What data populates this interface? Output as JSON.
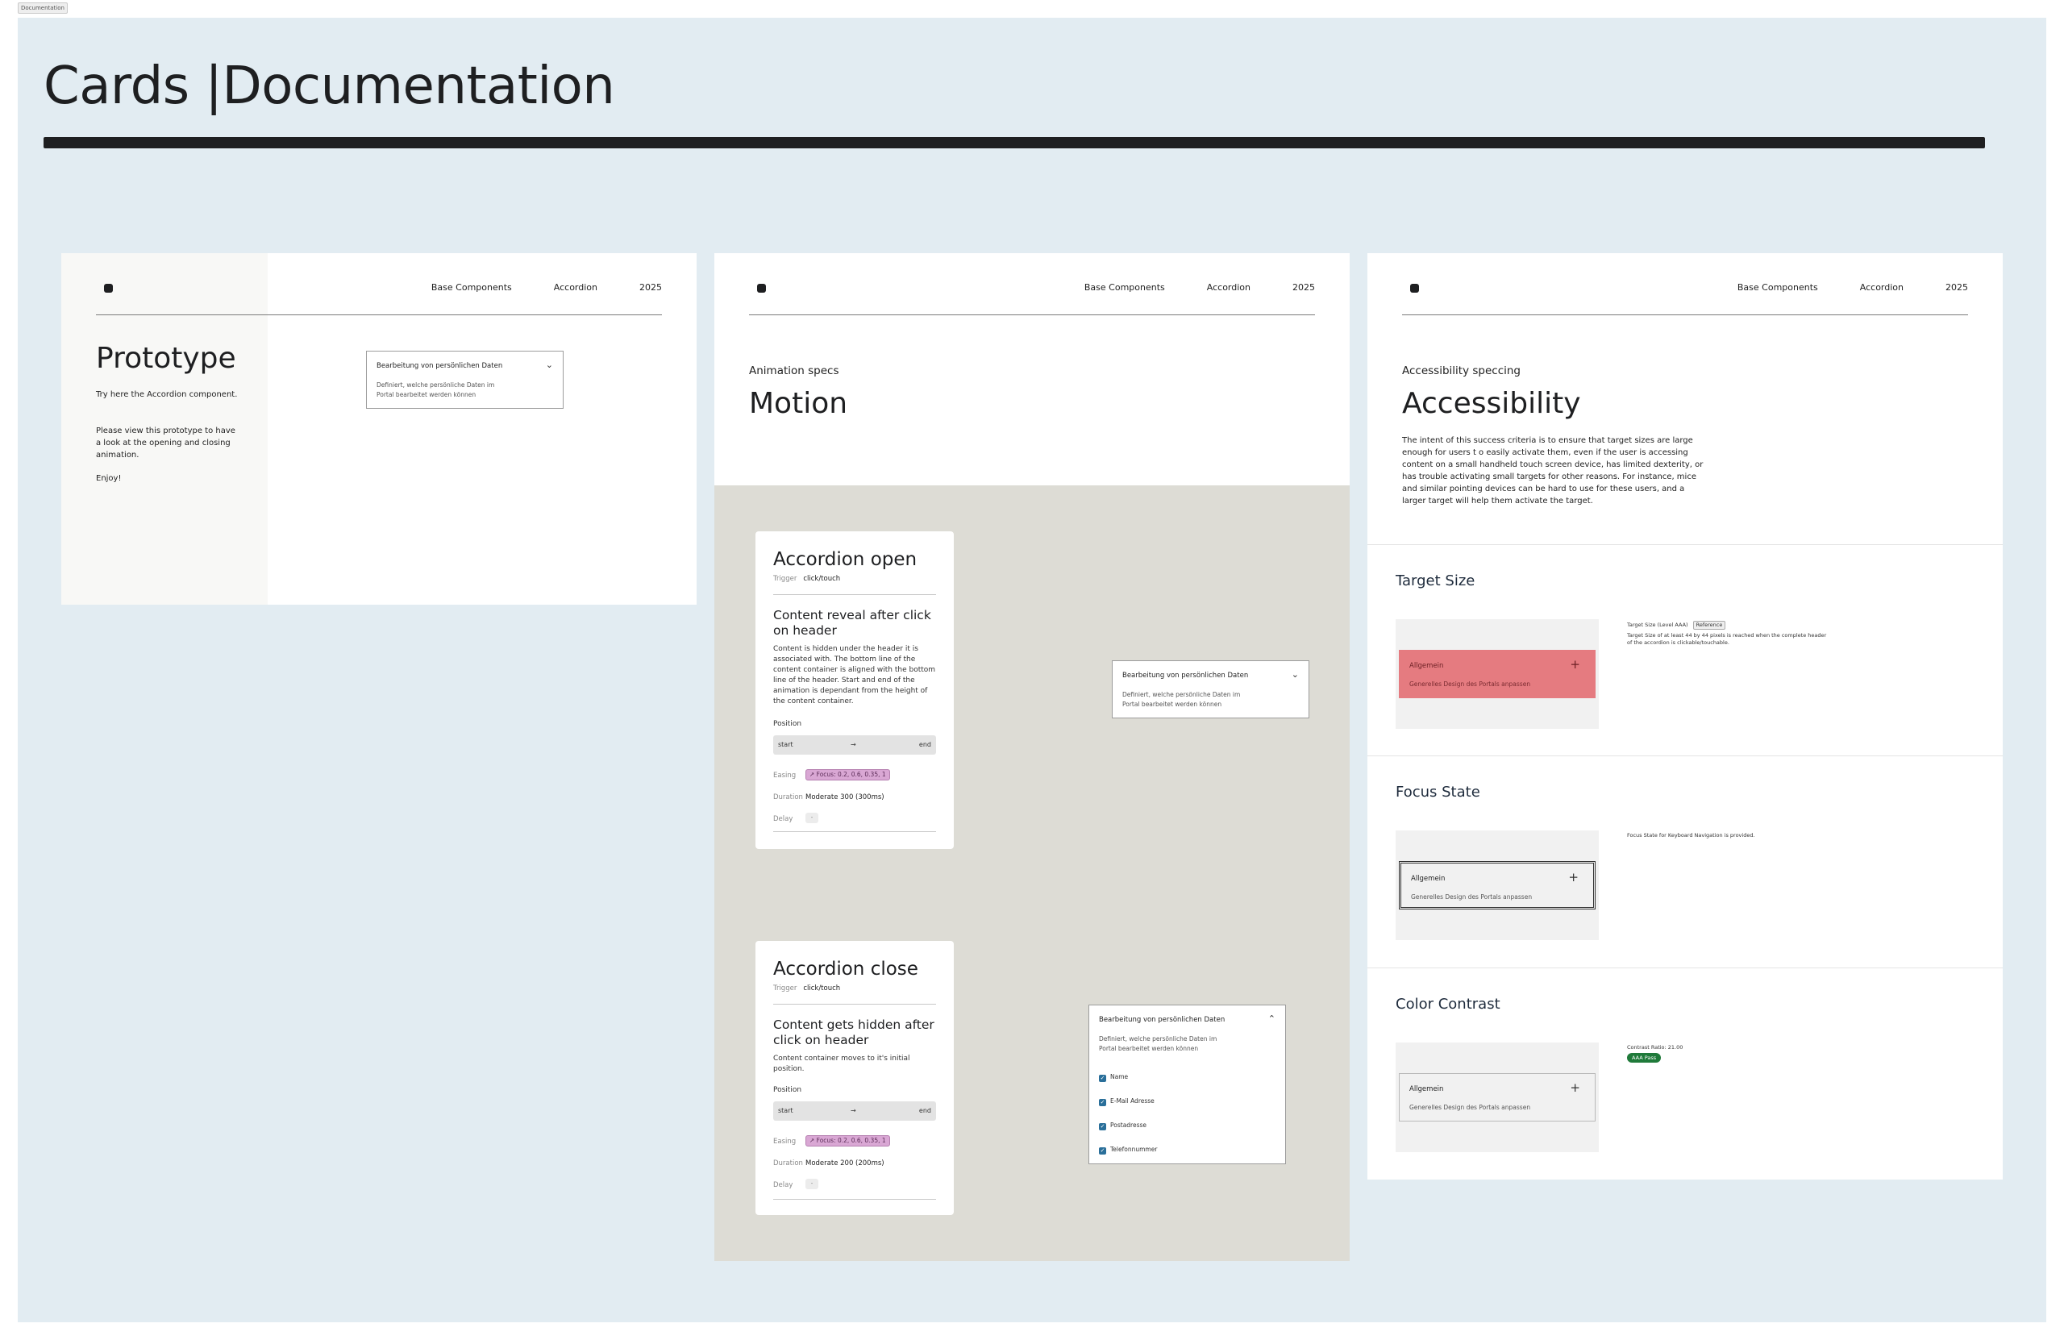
{
  "window_tag": "Documentation",
  "page": {
    "title": "Cards |Documentation"
  },
  "nav": {
    "items": [
      "Base Components",
      "Accordion",
      "2025"
    ]
  },
  "prototype": {
    "heading": "Prototype",
    "paragraphs": [
      "Try here the Accordion component.",
      "Please view this prototype to have a look at the opening and closing animation.",
      "Enjoy!"
    ],
    "accordion": {
      "header": "Bearbeitung von persönlichen Daten",
      "text": "Definiert, welche persönliche Daten im Portal bearbeitet werden können"
    }
  },
  "motion": {
    "subtitle": "Animation specs",
    "heading": "Motion",
    "open_spec": {
      "title": "Accordion open",
      "trigger_label": "Trigger",
      "trigger_value": "click/touch",
      "subtitle": "Content reveal after click on header",
      "description": "Content is hidden under the header it is associated with. The bottom line of the content container is aligned with the bottom line of the header. Start and end of the animation is dependant from the height of the content container.",
      "position_label": "Position",
      "pos_start": "start",
      "pos_arrow": "→",
      "pos_end": "end",
      "easing_label": "Easing",
      "easing_value": "↗ Focus: 0.2, 0.6, 0.35, 1",
      "duration_label": "Duration",
      "duration_value": "Moderate 300 (300ms)",
      "delay_label": "Delay",
      "delay_value": "-"
    },
    "close_spec": {
      "title": "Accordion close",
      "trigger_label": "Trigger",
      "trigger_value": "click/touch",
      "subtitle": "Content gets hidden after click on header",
      "description": "Content container moves to it's initial position.",
      "position_label": "Position",
      "pos_start": "start",
      "pos_arrow": "→",
      "pos_end": "end",
      "easing_label": "Easing",
      "easing_value": "↗ Focus: 0.2, 0.6, 0.35, 1",
      "duration_label": "Duration",
      "duration_value": "Moderate 200 (200ms)",
      "delay_label": "Delay",
      "delay_value": "-"
    },
    "closed_accordion": {
      "header": "Bearbeitung von persönlichen Daten",
      "text": "Definiert, welche persönliche Daten im Portal bearbeitet werden können"
    },
    "open_accordion": {
      "header": "Bearbeitung von persönlichen Daten",
      "text": "Definiert, welche persönliche Daten im Portal bearbeitet werden können",
      "options": [
        "Name",
        "E-Mail Adresse",
        "Postadresse",
        "Telefonnummer"
      ]
    }
  },
  "accessibility": {
    "subtitle": "Accessibility speccing",
    "heading": "Accessibility",
    "intro": "The intent of this success criteria is to ensure that target sizes are large enough  for users t o easily activate them, even if the user is accessing content on a small handheld touch screen device, has limited dexterity, or has trouble activating small targets for other reasons. For instance, mice and similar pointing devices can be hard to use for these users, and a larger target will help them activate the target.",
    "item_header": "Allgemein",
    "item_text": "Generelles Design des Portals anpassen",
    "target_size": {
      "title": "Target Size",
      "note_title": "Target Size (Level AAA)",
      "reference": "Reference",
      "note": "Target Size of at least 44 by 44 pixels is reached when the complete header of the accordion is clickable/touchable."
    },
    "focus_state": {
      "title": "Focus State",
      "note": "Focus State for Keyboard Navigation is provided."
    },
    "color_contrast": {
      "title": "Color Contrast",
      "note": "Contrast Ratio: 21.00",
      "badge": "AAA Pass"
    }
  },
  "colors": {
    "canvas_bg": "#e2ecf2",
    "target_highlight": "#e57b80",
    "focus_outline": "#333333",
    "pass_badge": "#1f7a3a",
    "easing_pill": "#d9a7d4",
    "checkbox": "#2a6f9a"
  }
}
